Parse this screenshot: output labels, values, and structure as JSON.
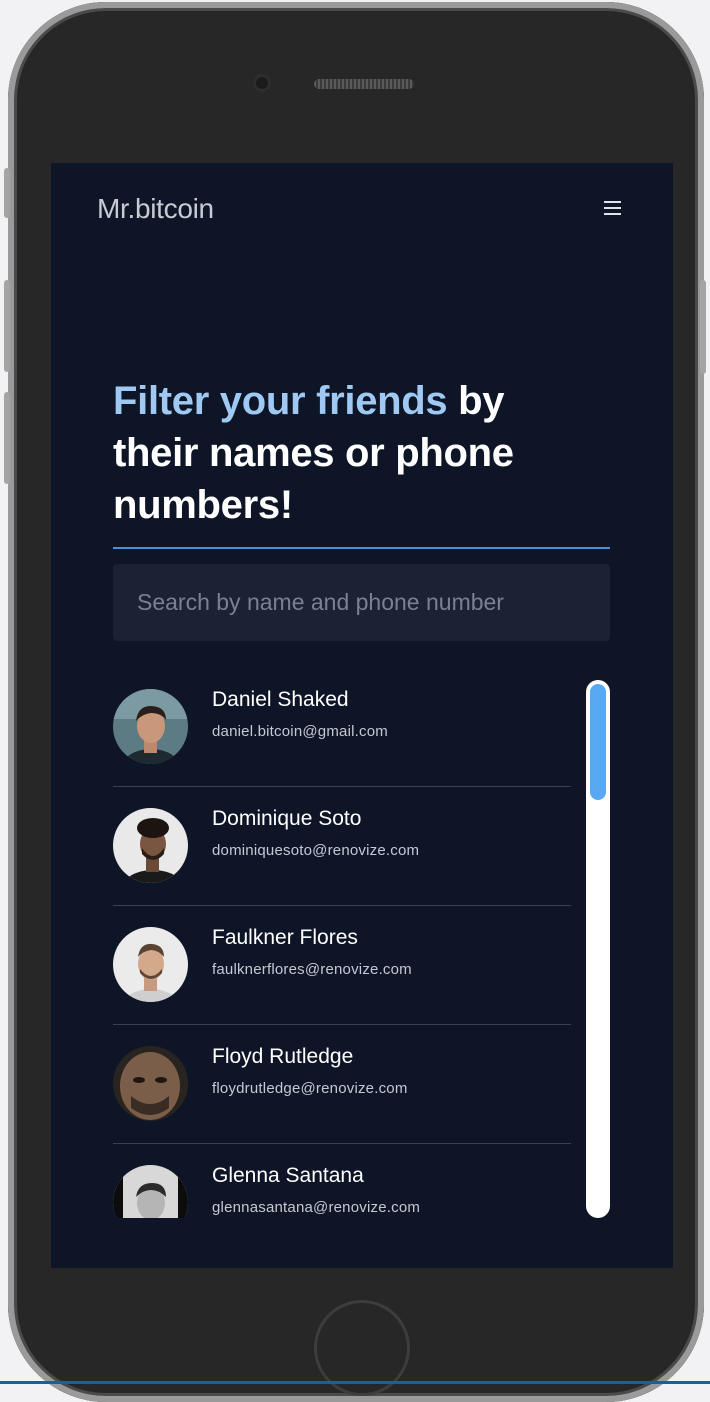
{
  "app": {
    "brand": "Mr.bitcoin",
    "menu_icon": "hamburger-menu-icon"
  },
  "hero": {
    "headline_highlight": "Filter your friends",
    "headline_rest": " by their names or phone numbers!"
  },
  "search": {
    "placeholder": "Search by name and phone number",
    "value": ""
  },
  "contacts": [
    {
      "name": "Daniel Shaked",
      "email": "daniel.bitcoin@gmail.com"
    },
    {
      "name": "Dominique Soto",
      "email": "dominiquesoto@renovize.com"
    },
    {
      "name": "Faulkner Flores",
      "email": "faulknerflores@renovize.com"
    },
    {
      "name": "Floyd Rutledge",
      "email": "floydrutledge@renovize.com"
    },
    {
      "name": "Glenna Santana",
      "email": "glennasantana@renovize.com"
    }
  ],
  "scrollbar": {
    "position_fraction": 0
  },
  "colors": {
    "background": "#0e1527",
    "accent": "#9fc9f3",
    "scroll_thumb": "#58a8f2",
    "divider": "#4d8fd4"
  }
}
